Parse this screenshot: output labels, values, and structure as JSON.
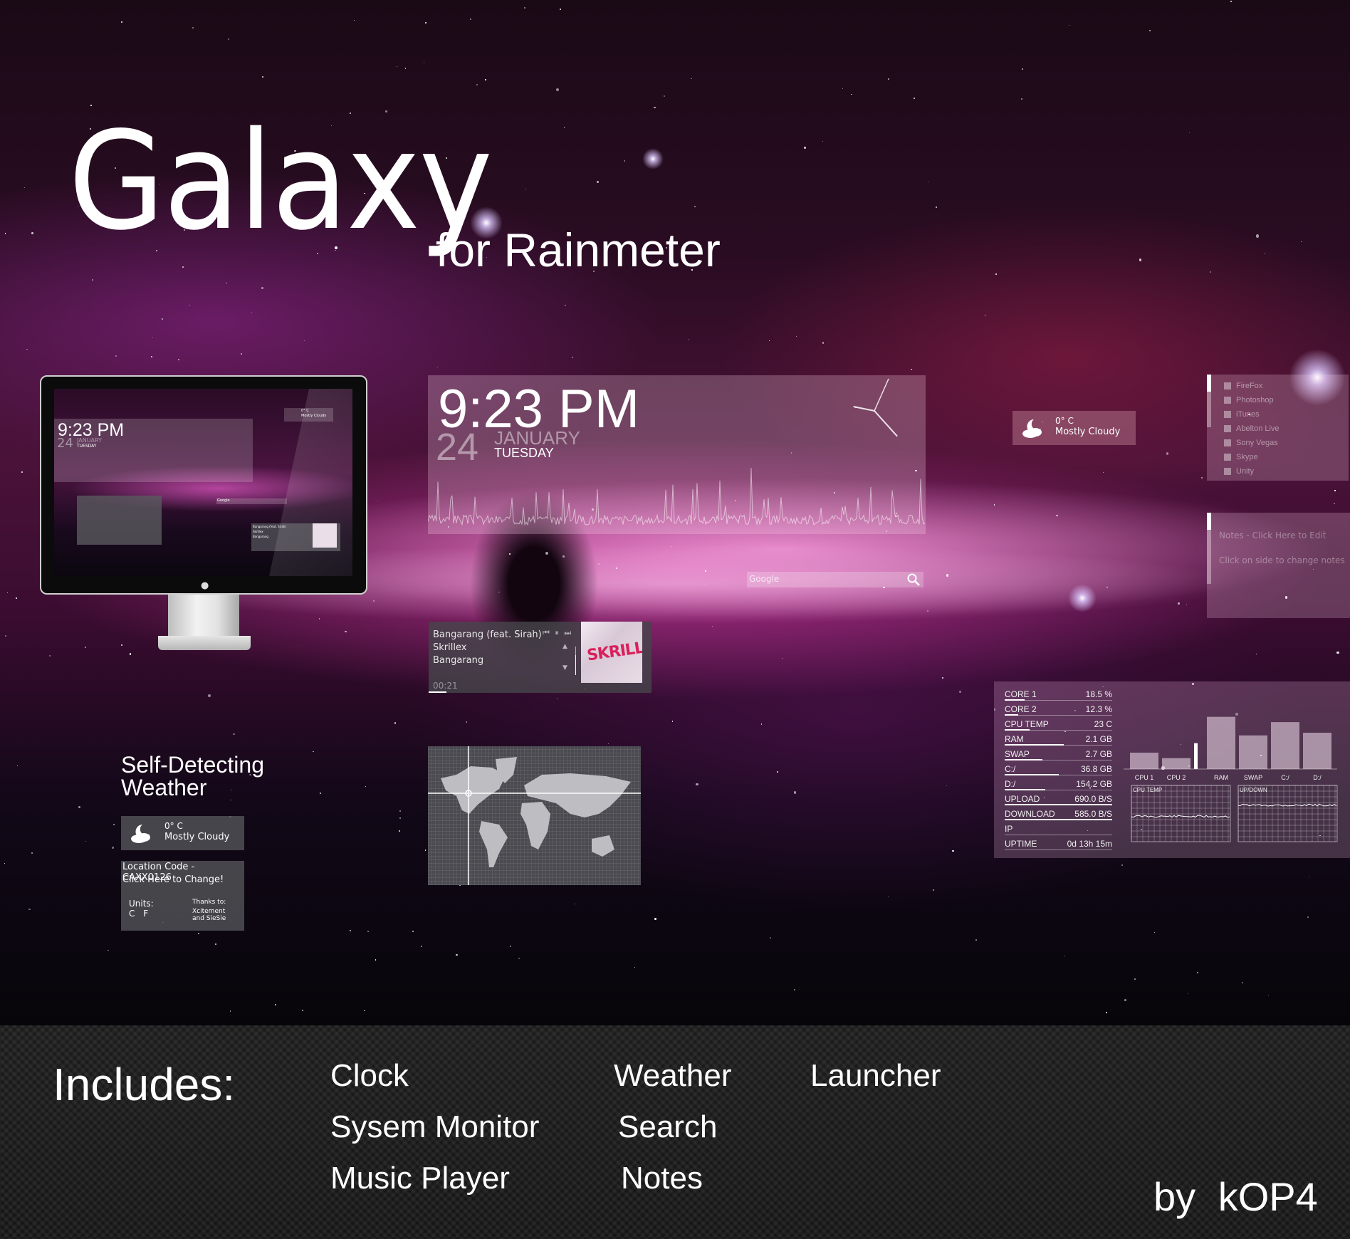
{
  "header": {
    "title": "Galaxy",
    "subtitle": "for Rainmeter"
  },
  "clock": {
    "time": "9:23 PM",
    "day": "24",
    "month": "JANUARY",
    "weekday": "TUESDAY",
    "analog_hour": 9,
    "analog_minute": 23
  },
  "weather": {
    "icon": "moon-cloud-icon",
    "temperature": "0° C",
    "condition": "Mostly Cloudy"
  },
  "launcher": {
    "items": [
      {
        "label": "FireFox"
      },
      {
        "label": "Photoshop"
      },
      {
        "label": "iTunes"
      },
      {
        "label": "Abelton Live"
      },
      {
        "label": "Sony Vegas"
      },
      {
        "label": "Skype"
      },
      {
        "label": "Unity"
      }
    ]
  },
  "notes": {
    "title": "Notes - Click Here to Edit",
    "hint": "Click on side to change notes"
  },
  "search": {
    "placeholder": "Google",
    "icon": "search-icon"
  },
  "music": {
    "track": "Bangarang (feat. Sirah)",
    "artist": "Skrillex",
    "album": "Bangarang",
    "elapsed": "00:21",
    "progress": 0.08,
    "controls": {
      "prev": "⏮",
      "pause": "⏸",
      "next": "⏭"
    },
    "volume": 0.7,
    "album_art_text": "SKRILLEX"
  },
  "map": {
    "marker_label": "location-marker"
  },
  "system_monitor": {
    "rows": [
      {
        "label": "CORE 1",
        "value": "18.5 %",
        "fill": 0.185
      },
      {
        "label": "CORE 2",
        "value": "12.3 %",
        "fill": 0.123
      },
      {
        "label": "CPU TEMP",
        "value": "23 C",
        "fill": 0.23
      },
      {
        "label": "RAM",
        "value": "2.1 GB",
        "fill": 0.55
      },
      {
        "label": "SWAP",
        "value": "2.7 GB",
        "fill": 0.35
      },
      {
        "label": "C:/",
        "value": "36.8 GB",
        "fill": 0.5
      },
      {
        "label": "D:/",
        "value": "154.2 GB",
        "fill": 0.38
      },
      {
        "label": "UPLOAD",
        "value": "690.0 B/S",
        "fill": 1.0
      },
      {
        "label": "DOWNLOAD",
        "value": "585.0 B/S",
        "fill": 1.0
      },
      {
        "label": "IP",
        "value": "",
        "fill": 0
      },
      {
        "label": "UPTIME",
        "value": "0d 13h 15m",
        "fill": 0
      }
    ],
    "bars": {
      "categories": [
        "CPU 1",
        "CPU 2",
        "RAM",
        "SWAP",
        "C:/",
        "D:/"
      ],
      "values": [
        0.185,
        0.123,
        0.59,
        0.38,
        0.53,
        0.41
      ],
      "cpu_temp_marker": 0.33
    },
    "graphs": [
      {
        "label": "CPU TEMP",
        "level": 0.45
      },
      {
        "label": "UP/DOWN",
        "level": 0.65
      }
    ]
  },
  "promo": {
    "self_detecting_title_1": "Self-Detecting",
    "self_detecting_title_2": "Weather",
    "location_code": "Location Code - CAXX0126",
    "change_link": "Click Here to Change!",
    "units_label": "Units:",
    "units_options": "C F",
    "thanks_label": "Thanks to:",
    "thanks_1": "Xcitement",
    "thanks_2": "and SieSie"
  },
  "includes": {
    "heading": "Includes:",
    "features": [
      {
        "label": "Clock"
      },
      {
        "label": "Weather"
      },
      {
        "label": "Launcher"
      },
      {
        "label": "Sysem Monitor"
      },
      {
        "label": "Search"
      },
      {
        "label": "Music Player"
      },
      {
        "label": "Notes"
      }
    ]
  },
  "credit": "by kOP4",
  "mini_preview": {
    "time": "9:23 PM",
    "day": "24",
    "month": "JANUARY",
    "weekday": "TUESDAY",
    "temperature": "0° C",
    "condition": "Mostly Cloudy",
    "search": "Google",
    "track": "Bangarang (feat. Sirah)",
    "artist": "Skrillex",
    "album": "Bangarang",
    "elapsed": "00:21"
  }
}
